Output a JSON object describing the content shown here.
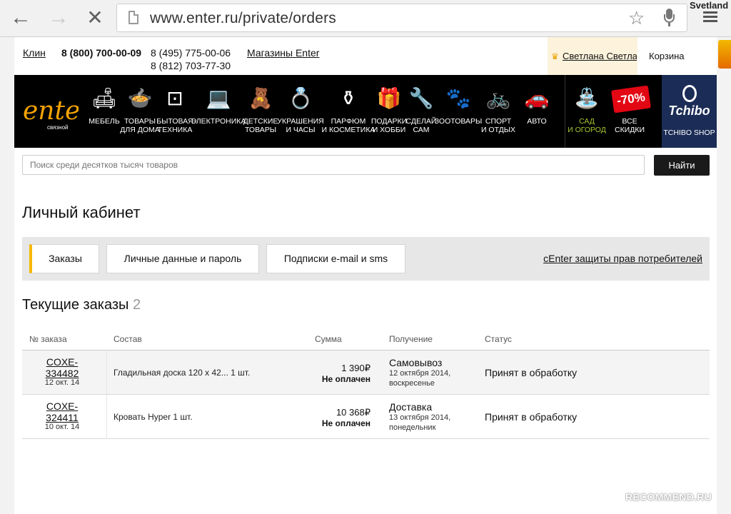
{
  "browser": {
    "url": "www.enter.ru/private/orders",
    "profile": "Svetland",
    "back_icon": "back-arrow-icon",
    "forward_icon": "forward-arrow-icon",
    "close_icon": "close-icon",
    "star_icon": "bookmark-star-icon",
    "mic_icon": "mic-icon",
    "menu_icon": "menu-icon"
  },
  "header": {
    "city": "Клин",
    "phone_main": "8 (800) 700-00-09",
    "phone_1": "8 (495) 775-00-06",
    "phone_2": "8 (812) 703-77-30",
    "stores_link": "Магазины Enter",
    "user_name": "Светлана Светлана",
    "cart": "Корзина"
  },
  "categories": [
    {
      "label": "МЕБЕЛЬ",
      "icon": "sofa-icon",
      "glyph": "🛋"
    },
    {
      "label": "ТОВАРЫ\nДЛЯ ДОМА",
      "icon": "pot-icon",
      "glyph": "🍲"
    },
    {
      "label": "БЫТОВАЯ\nТЕХНИКА",
      "icon": "washer-icon",
      "glyph": "⊡"
    },
    {
      "label": "ЭЛЕКТРОНИКА",
      "icon": "laptop-icon",
      "glyph": "💻"
    },
    {
      "label": "ДЕТСКИЕ\nТОВАРЫ",
      "icon": "teddy-bear-icon",
      "glyph": "🧸"
    },
    {
      "label": "УКРАШЕНИЯ\nИ ЧАСЫ",
      "icon": "ring-icon",
      "glyph": "💍"
    },
    {
      "label": "ПАРФЮМ\nИ КОСМЕТИКА",
      "icon": "perfume-icon",
      "glyph": "⚱"
    },
    {
      "label": "ПОДАРКИ\nИ ХОББИ",
      "icon": "gift-icon",
      "glyph": "🎁"
    },
    {
      "label": "СДЕЛАЙ\nСАМ",
      "icon": "tools-icon",
      "glyph": "🔧"
    },
    {
      "label": "ЗООТОВАРЫ",
      "icon": "paw-icon",
      "glyph": "🐾"
    },
    {
      "label": "СПОРТ\nИ ОТДЫХ",
      "icon": "bicycle-icon",
      "glyph": "🚲"
    },
    {
      "label": "АВТО",
      "icon": "car-icon",
      "glyph": "🚗"
    },
    {
      "label": "САД\nИ ОГОРОД",
      "icon": "watering-can-icon",
      "glyph": "⛲"
    },
    {
      "label": "ВСЕ\nСКИДКИ",
      "icon": "sale-badge-icon",
      "glyph": ""
    }
  ],
  "sale_badge": "-70%",
  "tchibo": {
    "logo": "Tchibo",
    "label": "TCHIBO SHOP"
  },
  "search": {
    "placeholder": "Поиск среди десятков тысяч товаров",
    "button": "Найти"
  },
  "page_title": "Личный кабинет",
  "tabs": [
    {
      "label": "Заказы"
    },
    {
      "label": "Личные данные и пароль"
    },
    {
      "label": "Подписки e-mail и sms"
    }
  ],
  "tab_link": "сEnter защиты прав потребителей",
  "orders": {
    "title": "Текущие заказы",
    "count": "2",
    "columns": [
      "№ заказа",
      "Состав",
      "Сумма",
      "Получение",
      "Статус"
    ],
    "rows": [
      {
        "number": "COXE-\n334482",
        "date": "12 окт. 14",
        "items": "Гладильная доска 120 х 42... 1 шт.",
        "sum": "1 390₽",
        "paid": "Не оплачен",
        "delivery": "Самовывоз",
        "delivery_date": "12 октября 2014, воскресенье",
        "status": "Принят в обработку"
      },
      {
        "number": "COXE-\n324411",
        "date": "10 окт. 14",
        "items": "Кровать Hyper 1 шт.",
        "sum": "10 368₽",
        "paid": "Не оплачен",
        "delivery": "Доставка",
        "delivery_date": "13 октября 2014, понедельник",
        "status": "Принят в обработку"
      }
    ]
  },
  "watermark": "RECOMMEND.RU",
  "colors": {
    "accent": "#f5b800",
    "topbar_bg": "#000000",
    "tchibo_bg": "#1b2c56",
    "sale_red": "#e30613",
    "garden_green": "#a6c531"
  }
}
